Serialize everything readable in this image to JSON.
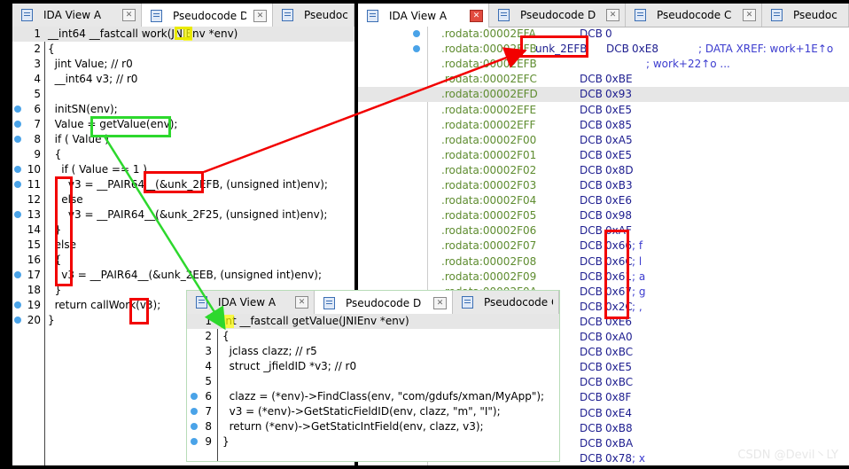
{
  "left_pane": {
    "tabs": [
      "IDA View A",
      "Pseudocode D",
      "Pseudoc"
    ],
    "line_numbers": [
      "1",
      "2",
      "3",
      "4",
      "5",
      "6",
      "7",
      "8",
      "9",
      "10",
      "11",
      "12",
      "13",
      "14",
      "15",
      "16",
      "17",
      "18",
      "19",
      "20"
    ],
    "code": [
      "__int64 __fastcall work(JNIEnv *env)",
      "{",
      "  jint Value; // r0",
      "  __int64 v3; // r0",
      "",
      "  initSN(env);",
      "  Value = getValue(env);",
      "  if ( Value )",
      "  {",
      "    if ( Value == 1 )",
      "      v3 = __PAIR64__(&unk_2EFB, (unsigned int)env);",
      "    else",
      "      v3 = __PAIR64__(&unk_2F25, (unsigned int)env);",
      "  }",
      "  else",
      "  {",
      "    v3 = __PAIR64__(&unk_2EEB, (unsigned int)env);",
      "  }",
      "  return callWork(v3);",
      "}"
    ]
  },
  "right_pane": {
    "tabs": [
      "IDA View A",
      "Pseudocode D",
      "Pseudocode C",
      "Pseudoc"
    ],
    "rows": [
      {
        "addr": ".rodata:00002EFA",
        "name": "",
        "op": "DCB",
        "val": "0",
        "comment": ""
      },
      {
        "addr": ".rodata:00002EFB",
        "name": "unk_2EFB",
        "op": "DCB",
        "val": "0xE8",
        "comment": "; DATA XREF: work+1E↑o"
      },
      {
        "addr": ".rodata:00002EFB",
        "name": "",
        "op": "",
        "val": "",
        "comment": "; work+22↑o ..."
      },
      {
        "addr": ".rodata:00002EFC",
        "name": "",
        "op": "DCB",
        "val": "0xBE",
        "comment": ""
      },
      {
        "addr": ".rodata:00002EFD",
        "name": "",
        "op": "DCB",
        "val": "0x93",
        "comment": ""
      },
      {
        "addr": ".rodata:00002EFE",
        "name": "",
        "op": "DCB",
        "val": "0xE5",
        "comment": ""
      },
      {
        "addr": ".rodata:00002EFF",
        "name": "",
        "op": "DCB",
        "val": "0x85",
        "comment": ""
      },
      {
        "addr": ".rodata:00002F00",
        "name": "",
        "op": "DCB",
        "val": "0xA5",
        "comment": ""
      },
      {
        "addr": ".rodata:00002F01",
        "name": "",
        "op": "DCB",
        "val": "0xE5",
        "comment": ""
      },
      {
        "addr": ".rodata:00002F02",
        "name": "",
        "op": "DCB",
        "val": "0x8D",
        "comment": ""
      },
      {
        "addr": ".rodata:00002F03",
        "name": "",
        "op": "DCB",
        "val": "0xB3",
        "comment": ""
      },
      {
        "addr": ".rodata:00002F04",
        "name": "",
        "op": "DCB",
        "val": "0xE6",
        "comment": ""
      },
      {
        "addr": ".rodata:00002F05",
        "name": "",
        "op": "DCB",
        "val": "0x98",
        "comment": ""
      },
      {
        "addr": ".rodata:00002F06",
        "name": "",
        "op": "DCB",
        "val": "0xAF",
        "comment": ""
      },
      {
        "addr": ".rodata:00002F07",
        "name": "",
        "op": "DCB",
        "val": "0x66",
        "comment": "; f"
      },
      {
        "addr": ".rodata:00002F08",
        "name": "",
        "op": "DCB",
        "val": "0x6C",
        "comment": "; l"
      },
      {
        "addr": ".rodata:00002F09",
        "name": "",
        "op": "DCB",
        "val": "0x61",
        "comment": "; a"
      },
      {
        "addr": ".rodata:00002F0A",
        "name": "",
        "op": "DCB",
        "val": "0x67",
        "comment": "; g"
      },
      {
        "addr": "",
        "name": "",
        "op": "DCB",
        "val": "0x2C",
        "comment": "; ,"
      },
      {
        "addr": "",
        "name": "",
        "op": "DCB",
        "val": "0xE6",
        "comment": ""
      },
      {
        "addr": "",
        "name": "",
        "op": "DCB",
        "val": "0xA0",
        "comment": ""
      },
      {
        "addr": "",
        "name": "",
        "op": "DCB",
        "val": "0xBC",
        "comment": ""
      },
      {
        "addr": "",
        "name": "",
        "op": "DCB",
        "val": "0xE5",
        "comment": ""
      },
      {
        "addr": "",
        "name": "",
        "op": "DCB",
        "val": "0xBC",
        "comment": ""
      },
      {
        "addr": "",
        "name": "",
        "op": "DCB",
        "val": "0x8F",
        "comment": ""
      },
      {
        "addr": "",
        "name": "",
        "op": "DCB",
        "val": "0xE4",
        "comment": ""
      },
      {
        "addr": "",
        "name": "",
        "op": "DCB",
        "val": "0xB8",
        "comment": ""
      },
      {
        "addr": "",
        "name": "",
        "op": "DCB",
        "val": "0xBA",
        "comment": ""
      },
      {
        "addr": "",
        "name": "",
        "op": "DCB",
        "val": "0x78",
        "comment": "; x"
      }
    ]
  },
  "popup_pane": {
    "tabs": [
      "IDA View A",
      "Pseudocode D",
      "Pseudocode C"
    ],
    "line_numbers": [
      "1",
      "2",
      "3",
      "4",
      "5",
      "6",
      "7",
      "8",
      "9"
    ],
    "code": [
      "int __fastcall getValue(JNIEnv *env)",
      "{",
      "  jclass clazz; // r5",
      "  struct _jfieldID *v3; // r0",
      "",
      "  clazz = (*env)->FindClass(env, \"com/gdufs/xman/MyApp\");",
      "  v3 = (*env)->GetStaticFieldID(env, clazz, \"m\", \"I\");",
      "  return (*env)->GetStaticIntField(env, clazz, v3);",
      "}"
    ]
  },
  "watermark": "CSDN @Devil丶LY",
  "colors": {
    "annotation_red": "#f20000",
    "annotation_green": "#2dd82d",
    "breakpoint_dot": "#4aa3e8"
  }
}
